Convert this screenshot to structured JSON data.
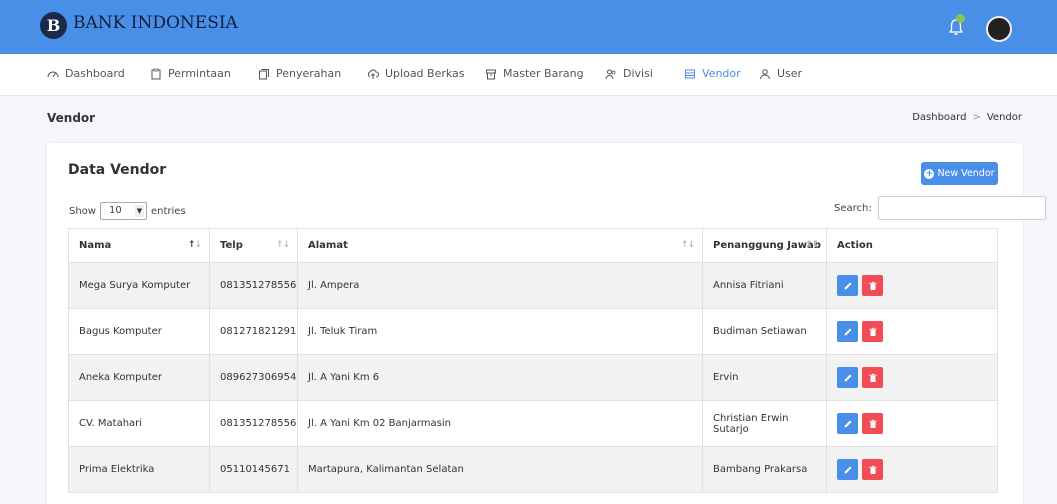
{
  "brand": {
    "logo_letter": "B",
    "name": "BANK INDONESIA"
  },
  "colors": {
    "primary": "#4a8fe7",
    "danger": "#f24d57",
    "badge": "#8bc34a"
  },
  "nav": [
    {
      "label": "Dashboard",
      "icon": "dashboard-icon"
    },
    {
      "label": "Permintaan",
      "icon": "clipboard-icon"
    },
    {
      "label": "Penyerahan",
      "icon": "copy-icon"
    },
    {
      "label": "Upload Berkas",
      "icon": "upload-icon"
    },
    {
      "label": "Master Barang",
      "icon": "box-icon"
    },
    {
      "label": "Divisi",
      "icon": "users-icon"
    },
    {
      "label": "Vendor",
      "icon": "vendor-icon",
      "active": true
    },
    {
      "label": "User",
      "icon": "user-icon"
    }
  ],
  "page": {
    "title": "Vendor",
    "breadcrumb": [
      "Dashboard",
      "Vendor"
    ],
    "breadcrumb_sep": ">"
  },
  "card": {
    "title": "Data Vendor",
    "new_button": "New Vendor",
    "show_label": "Show",
    "entries_value": "10",
    "entries_label": "entries",
    "search_label": "Search:",
    "search_value": ""
  },
  "table": {
    "columns": [
      "Nama",
      "Telp",
      "Alamat",
      "Penanggung Jawab",
      "Action"
    ],
    "rows": [
      [
        "Mega Surya Komputer",
        "081351278556",
        "Jl. Ampera",
        "Annisa Fitriani"
      ],
      [
        "Bagus Komputer",
        "081271821291",
        "Jl. Teluk Tiram",
        "Budiman Setiawan"
      ],
      [
        "Aneka Komputer",
        "089627306954",
        "Jl. A Yani Km 6",
        "Ervin"
      ],
      [
        "CV. Matahari",
        "081351278556",
        "Jl. A Yani Km 02 Banjarmasin",
        "Christian Erwin Sutarjo"
      ],
      [
        "Prima Elektrika",
        "05110145671",
        "Martapura, Kalimantan Selatan",
        "Bambang Prakarsa"
      ]
    ]
  }
}
